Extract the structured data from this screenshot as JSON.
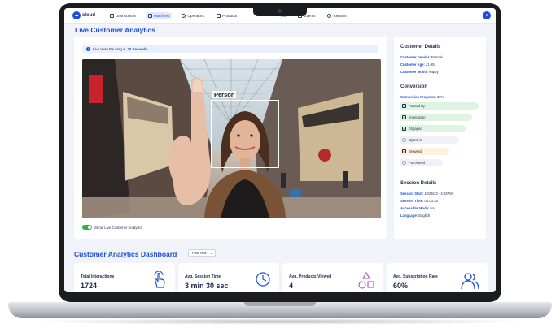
{
  "nav": {
    "logo": "cloud",
    "items": [
      {
        "label": "Dashboards",
        "active": false
      },
      {
        "label": "Machines",
        "active": true
      },
      {
        "label": "Operators",
        "active": false
      },
      {
        "label": "Products",
        "active": false
      },
      {
        "label": "ent",
        "active": false
      },
      {
        "label": "Events",
        "active": false
      },
      {
        "label": "Reports",
        "active": false
      }
    ]
  },
  "page_title": "Live Customer Analytics",
  "video": {
    "info_text": "Live View Pausing in",
    "info_highlight": "30 Seconds.",
    "detection_label": "Person",
    "toggle_label": "Show Live Customer Analytics"
  },
  "customer_details": {
    "title": "Customer Details",
    "rows": [
      {
        "key": "Customer Gender:",
        "value": "Female"
      },
      {
        "key": "Customer Age:",
        "value": "21-25"
      },
      {
        "key": "Customer Mood:",
        "value": "Happy"
      }
    ]
  },
  "conversion": {
    "title": "Conversion",
    "progress_key": "Conversion Progress:",
    "progress_value": "60%",
    "steps": [
      {
        "label": "Passed By",
        "checked": true
      },
      {
        "label": "Impression",
        "checked": true
      },
      {
        "label": "Engaged",
        "checked": true
      },
      {
        "label": "Opted-in",
        "checked": false
      },
      {
        "label": "Browsed",
        "checked": true
      },
      {
        "label": "Purchased",
        "checked": false
      }
    ]
  },
  "session_details": {
    "title": "Session Details",
    "rows": [
      {
        "key": "Session Start:",
        "value": "10/26/23 - 4:22PM"
      },
      {
        "key": "Session Time:",
        "value": "00:03:25"
      },
      {
        "key": "Accessible Mode:",
        "value": "No"
      },
      {
        "key": "Language:",
        "value": "English"
      }
    ]
  },
  "dashboard": {
    "title": "Customer Analytics Dashboard",
    "range": "Past Year",
    "stats": [
      {
        "label": "Total Interactions",
        "value": "1724",
        "icon": "tap-hand-icon"
      },
      {
        "label": "Avg. Session Time",
        "value": "3 min 30 sec",
        "icon": "clock-icon"
      },
      {
        "label": "Avg. Products Viewed",
        "value": "4",
        "icon": "shapes-icon"
      },
      {
        "label": "Avg. Subscription Rate",
        "value": "60%",
        "icon": "users-icon"
      }
    ]
  },
  "colors": {
    "accent": "#1e4fd8",
    "success": "#2bb24c"
  }
}
